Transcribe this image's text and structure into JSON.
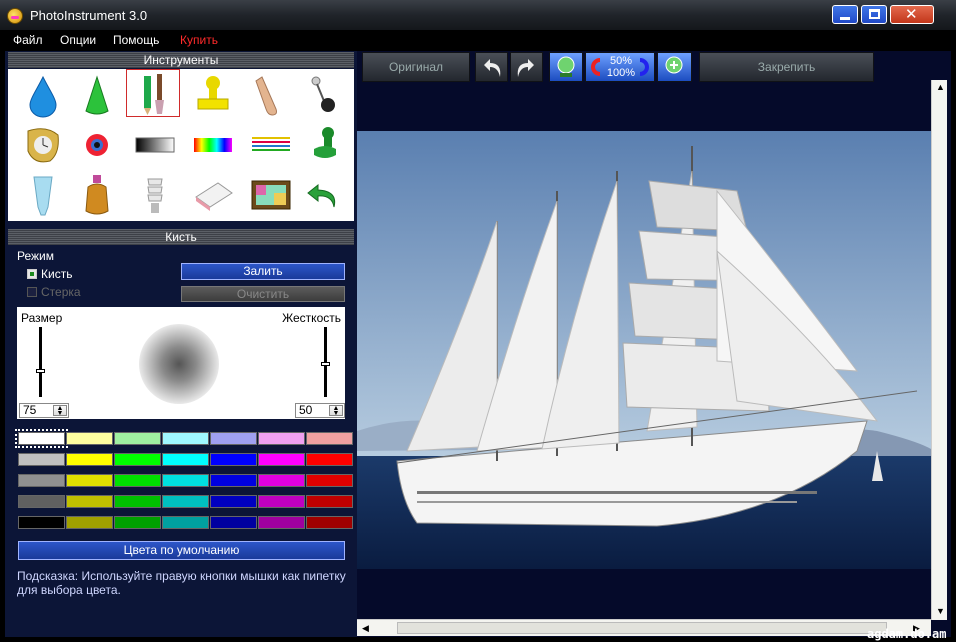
{
  "window": {
    "title": "PhotoInstrument 3.0"
  },
  "menu": {
    "file": "Файл",
    "options": "Опции",
    "help": "Помощь",
    "buy": "Купить"
  },
  "tools_panel": {
    "title": "Инструменты",
    "icons": [
      "drop-icon",
      "cone-icon",
      "brush-pencil-icon",
      "stamp-icon",
      "finger-icon",
      "pin-icon",
      "clock-icon",
      "eye-icon",
      "gradient-icon",
      "rainbow-icon",
      "lines-icon",
      "push-pin-icon",
      "tube-icon",
      "bottle-icon",
      "bulb-icon",
      "eraser-icon",
      "tv-icon",
      "undo-arrow-icon"
    ]
  },
  "brush_panel": {
    "title": "Кисть",
    "mode_label": "Режим",
    "mode_brush": "Кисть",
    "mode_eraser": "Стерка",
    "fill_button": "Залить",
    "clear_button": "Очистить",
    "size_label": "Размер",
    "hardness_label": "Жесткость",
    "size_value": "75",
    "hardness_value": "50",
    "palette": [
      [
        "#ffffff",
        "#ffffa0",
        "#a0f0a0",
        "#a0f8ff",
        "#a0a0f0",
        "#f0a0f0",
        "#f0a0a0"
      ],
      [
        "#c0c0c0",
        "#ffff00",
        "#00ff00",
        "#00ffff",
        "#0000ff",
        "#ff00ff",
        "#ff0000"
      ],
      [
        "#909090",
        "#e0e000",
        "#00e000",
        "#00e0e0",
        "#0000e0",
        "#e000e0",
        "#e00000"
      ],
      [
        "#606060",
        "#c0c000",
        "#00c000",
        "#00c0c0",
        "#0000c0",
        "#c000c0",
        "#c00000"
      ],
      [
        "#000000",
        "#a0a000",
        "#00a000",
        "#00a0a0",
        "#0000a0",
        "#a000a0",
        "#a00000"
      ]
    ],
    "default_colors_button": "Цвета по умолчанию",
    "hint": "Подсказка: Используйте правую кнопки мышки как пипетку для выбора цвета."
  },
  "toolbar": {
    "original": "Оригинал",
    "zoom_top": "50%",
    "zoom_bottom": "100%",
    "pin": "Закрепить"
  },
  "watermark": "agdam.do.am",
  "colors": {
    "panel_bg": "#0c1537",
    "accent_blue": "#2d56c9",
    "buy_red": "#ff2a2a"
  }
}
